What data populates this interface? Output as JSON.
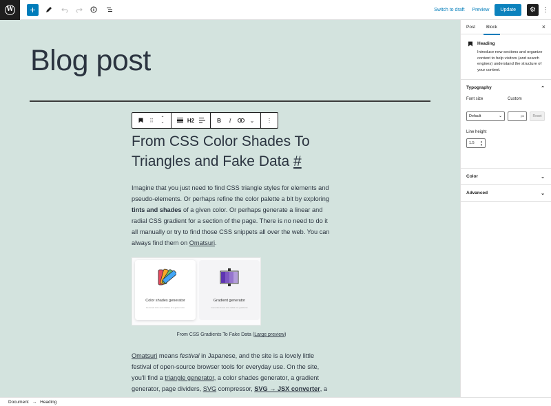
{
  "topbar": {
    "switch_draft": "Switch to draft",
    "preview": "Preview",
    "update": "Update",
    "add": "+",
    "wp_logo": "W"
  },
  "canvas": {
    "post_title": "Blog post",
    "toolbar": {
      "heading_level": "H2"
    },
    "heading": "From CSS Color Shades To Triangles and Fake Data",
    "heading_anchor": "#",
    "para1": {
      "t1": "Imagine that you just need to find CSS triangle styles for elements and pseudo-elements. Or perhaps refine the color palette a bit by exploring ",
      "b1": "tints and shades",
      "t2": " of a given color. Or perhaps generate a linear and radial CSS gradient for a section of the page. There is no need to do it all manually or try to find those CSS snippets all over the web. You can always find them on ",
      "link": "Omatsuri",
      "t3": "."
    },
    "image": {
      "card1_title": "Color shades generator",
      "card1_sub": "Generate tints and shades of a given color",
      "card2_title": "Gradient generator",
      "card2_sub": "Generate linear and radial css gradients"
    },
    "caption": {
      "text": "From CSS Gradients To Fake Data (",
      "link": "Large preview",
      "end": ")"
    },
    "para2": {
      "l1": "Omatsuri",
      "t1": " means ",
      "i1": "festival",
      "t2": " in Japanese, and the site is a lovely little festival of open-source browser tools for everyday use. On the site, you'll find a ",
      "l2": "triangle generator",
      "t3": ", a color shades generator, a gradient generator, page dividers, ",
      "l3": "SVG",
      "t4": " compressor, ",
      "b1": "SVG → JSX converter",
      "t5": ", a"
    }
  },
  "sidebar": {
    "tab_post": "Post",
    "tab_block": "Block",
    "close": "×",
    "block_title": "Heading",
    "block_desc": "Introduce new sections and organize content to help visitors (and search engines) understand the structure of your content.",
    "typography": {
      "title": "Typography",
      "font_size_label": "Font size",
      "custom_label": "Custom",
      "font_size_value": "Default",
      "unit": "px",
      "reset": "Reset",
      "line_height_label": "Line height",
      "line_height_value": "1.5"
    },
    "color": "Color",
    "advanced": "Advanced"
  },
  "footer": {
    "crumb1": "Document",
    "arrow": "→",
    "crumb2": "Heading"
  },
  "colors": {
    "accent": "#007cba",
    "canvas_bg": "#d3e3de",
    "dark": "#1e1e1e"
  }
}
